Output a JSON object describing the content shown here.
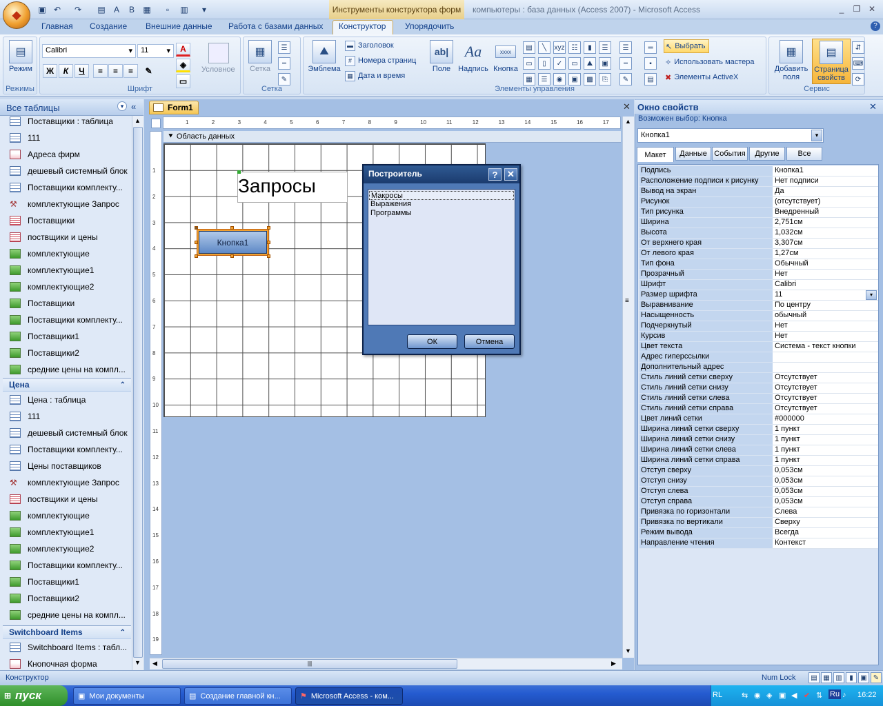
{
  "titlebar": {
    "contextual_tab": "Инструменты конструктора форм",
    "window_title": "компьютеры : база данных (Access 2007) - Microsoft Access"
  },
  "ribbon_tabs": [
    "Главная",
    "Создание",
    "Внешние данные",
    "Работа с базами данных",
    "Конструктор",
    "Упорядочить"
  ],
  "ribbon": {
    "views": {
      "button": "Режим",
      "group": "Режимы"
    },
    "font": {
      "name": "Calibri",
      "size": "11",
      "bold": "Ж",
      "italic": "К",
      "underline": "Ч",
      "conditional": "Условное",
      "group": "Шрифт"
    },
    "grid": {
      "button": "Сетка",
      "group": "Сетка"
    },
    "controls": {
      "logo": "Эмблема",
      "title": "Заголовок",
      "page_numbers": "Номера страниц",
      "date_time": "Дата и время",
      "field": "Поле",
      "label": "Надпись",
      "button": "Кнопка",
      "button_glyph": "xxxx",
      "field_glyph": "ab|",
      "label_glyph": "Aa",
      "select": "Выбрать",
      "use_wizard": "Использовать мастера",
      "activex": "Элементы ActiveX",
      "group": "Элементы управления"
    },
    "tools": {
      "add_field": "Добавить поля",
      "property_sheet": "Страница свойств",
      "group": "Сервис"
    }
  },
  "navpane": {
    "header": "Все таблицы",
    "groups": [
      {
        "title": "",
        "items": [
          {
            "label": "Поставщики : таблица",
            "kind": "table"
          },
          {
            "label": "111",
            "kind": "table"
          },
          {
            "label": "Адреса фирм",
            "kind": "form"
          },
          {
            "label": "дешевый системный блок",
            "kind": "table"
          },
          {
            "label": "Поставщики комплекту...",
            "kind": "table"
          },
          {
            "label": "комплектующие Запрос",
            "kind": "query"
          },
          {
            "label": "Поставщики",
            "kind": "report"
          },
          {
            "label": "поствщики и цены",
            "kind": "report"
          },
          {
            "label": "комплектующие",
            "kind": "macro"
          },
          {
            "label": "комплектующие1",
            "kind": "macro"
          },
          {
            "label": "комплектующие2",
            "kind": "macro"
          },
          {
            "label": "Поставщики",
            "kind": "macro"
          },
          {
            "label": "Поставщики комплекту...",
            "kind": "macro"
          },
          {
            "label": "Поставщики1",
            "kind": "macro"
          },
          {
            "label": "Поставщики2",
            "kind": "macro"
          },
          {
            "label": "средние цены на компл...",
            "kind": "macro"
          }
        ]
      },
      {
        "title": "Цена",
        "items": [
          {
            "label": "Цена : таблица",
            "kind": "table"
          },
          {
            "label": "111",
            "kind": "table"
          },
          {
            "label": "дешевый системный блок",
            "kind": "table"
          },
          {
            "label": "Поставщики комплекту...",
            "kind": "table"
          },
          {
            "label": "Цены поставщиков",
            "kind": "table"
          },
          {
            "label": "комплектующие Запрос",
            "kind": "query"
          },
          {
            "label": "поствщики и цены",
            "kind": "report"
          },
          {
            "label": "комплектующие",
            "kind": "macro"
          },
          {
            "label": "комплектующие1",
            "kind": "macro"
          },
          {
            "label": "комплектующие2",
            "kind": "macro"
          },
          {
            "label": "Поставщики комплекту...",
            "kind": "macro"
          },
          {
            "label": "Поставщики1",
            "kind": "macro"
          },
          {
            "label": "Поставщики2",
            "kind": "macro"
          },
          {
            "label": "средние цены на компл...",
            "kind": "macro"
          }
        ]
      },
      {
        "title": "Switchboard Items",
        "items": [
          {
            "label": "Switchboard Items : табл...",
            "kind": "table"
          },
          {
            "label": "Кнопочная форма",
            "kind": "form"
          }
        ]
      }
    ]
  },
  "document": {
    "tab": "Form1",
    "section": "Область данных",
    "title_label": "Запросы",
    "button_label": "Кнопка1",
    "hruler": [
      "1",
      "2",
      "3",
      "4",
      "5",
      "6",
      "7",
      "8",
      "9",
      "10",
      "11",
      "12",
      "13",
      "14",
      "15",
      "16",
      "17"
    ],
    "vruler": [
      "1",
      "2",
      "3",
      "4",
      "5",
      "6",
      "7",
      "8",
      "9",
      "10",
      "11",
      "12",
      "13",
      "14",
      "15",
      "16",
      "17",
      "18",
      "19"
    ]
  },
  "dialog": {
    "title": "Построитель",
    "items": [
      "Макросы",
      "Выражения",
      "Программы"
    ],
    "ok": "ОК",
    "cancel": "Отмена"
  },
  "properties": {
    "title": "Окно свойств",
    "selection_info": "Возможен выбор:  Кнопка",
    "selected": "Кнопка1",
    "tabs": [
      "Макет",
      "Данные",
      "События",
      "Другие",
      "Все"
    ],
    "rows": [
      [
        "Подпись",
        "Кнопка1"
      ],
      [
        "Расположение подписи к рисунку",
        "Нет подписи"
      ],
      [
        "Вывод на экран",
        "Да"
      ],
      [
        "Рисунок",
        "(отсутствует)"
      ],
      [
        "Тип рисунка",
        "Внедренный"
      ],
      [
        "Ширина",
        "2,751см"
      ],
      [
        "Высота",
        "1,032см"
      ],
      [
        "От верхнего края",
        "3,307см"
      ],
      [
        "От левого края",
        "1,27см"
      ],
      [
        "Тип фона",
        "Обычный"
      ],
      [
        "Прозрачный",
        "Нет"
      ],
      [
        "Шрифт",
        "Calibri"
      ],
      [
        "Размер шрифта",
        "11"
      ],
      [
        "Выравнивание",
        "По центру"
      ],
      [
        "Насыщенность",
        "обычный"
      ],
      [
        "Подчеркнутый",
        "Нет"
      ],
      [
        "Курсив",
        "Нет"
      ],
      [
        "Цвет текста",
        "Система - текст кнопки"
      ],
      [
        "Адрес гиперссылки",
        ""
      ],
      [
        "Дополнительный адрес",
        ""
      ],
      [
        "Стиль линий сетки сверху",
        "Отсутствует"
      ],
      [
        "Стиль линий сетки снизу",
        "Отсутствует"
      ],
      [
        "Стиль линий сетки слева",
        "Отсутствует"
      ],
      [
        "Стиль линий сетки справа",
        "Отсутствует"
      ],
      [
        "Цвет линий сетки",
        "#000000"
      ],
      [
        "Ширина линий сетки сверху",
        "1 пункт"
      ],
      [
        "Ширина линий сетки снизу",
        "1 пункт"
      ],
      [
        "Ширина линий сетки слева",
        "1 пункт"
      ],
      [
        "Ширина линий сетки справа",
        "1 пункт"
      ],
      [
        "Отступ сверху",
        "0,053см"
      ],
      [
        "Отступ снизу",
        "0,053см"
      ],
      [
        "Отступ слева",
        "0,053см"
      ],
      [
        "Отступ справа",
        "0,053см"
      ],
      [
        "Привязка по горизонтали",
        "Слева"
      ],
      [
        "Привязка по вертикали",
        "Сверху"
      ],
      [
        "Режим вывода",
        "Всегда"
      ],
      [
        "Направление чтения",
        "Контекст"
      ]
    ]
  },
  "statusbar": {
    "left": "Конструктор",
    "numlock": "Num Lock"
  },
  "taskbar": {
    "start": "пуск",
    "tasks": [
      "Мои документы",
      "Создание главной кн...",
      "Microsoft Access - ком..."
    ],
    "lang": "RL",
    "layout": "Ru",
    "clock": "16:22"
  }
}
